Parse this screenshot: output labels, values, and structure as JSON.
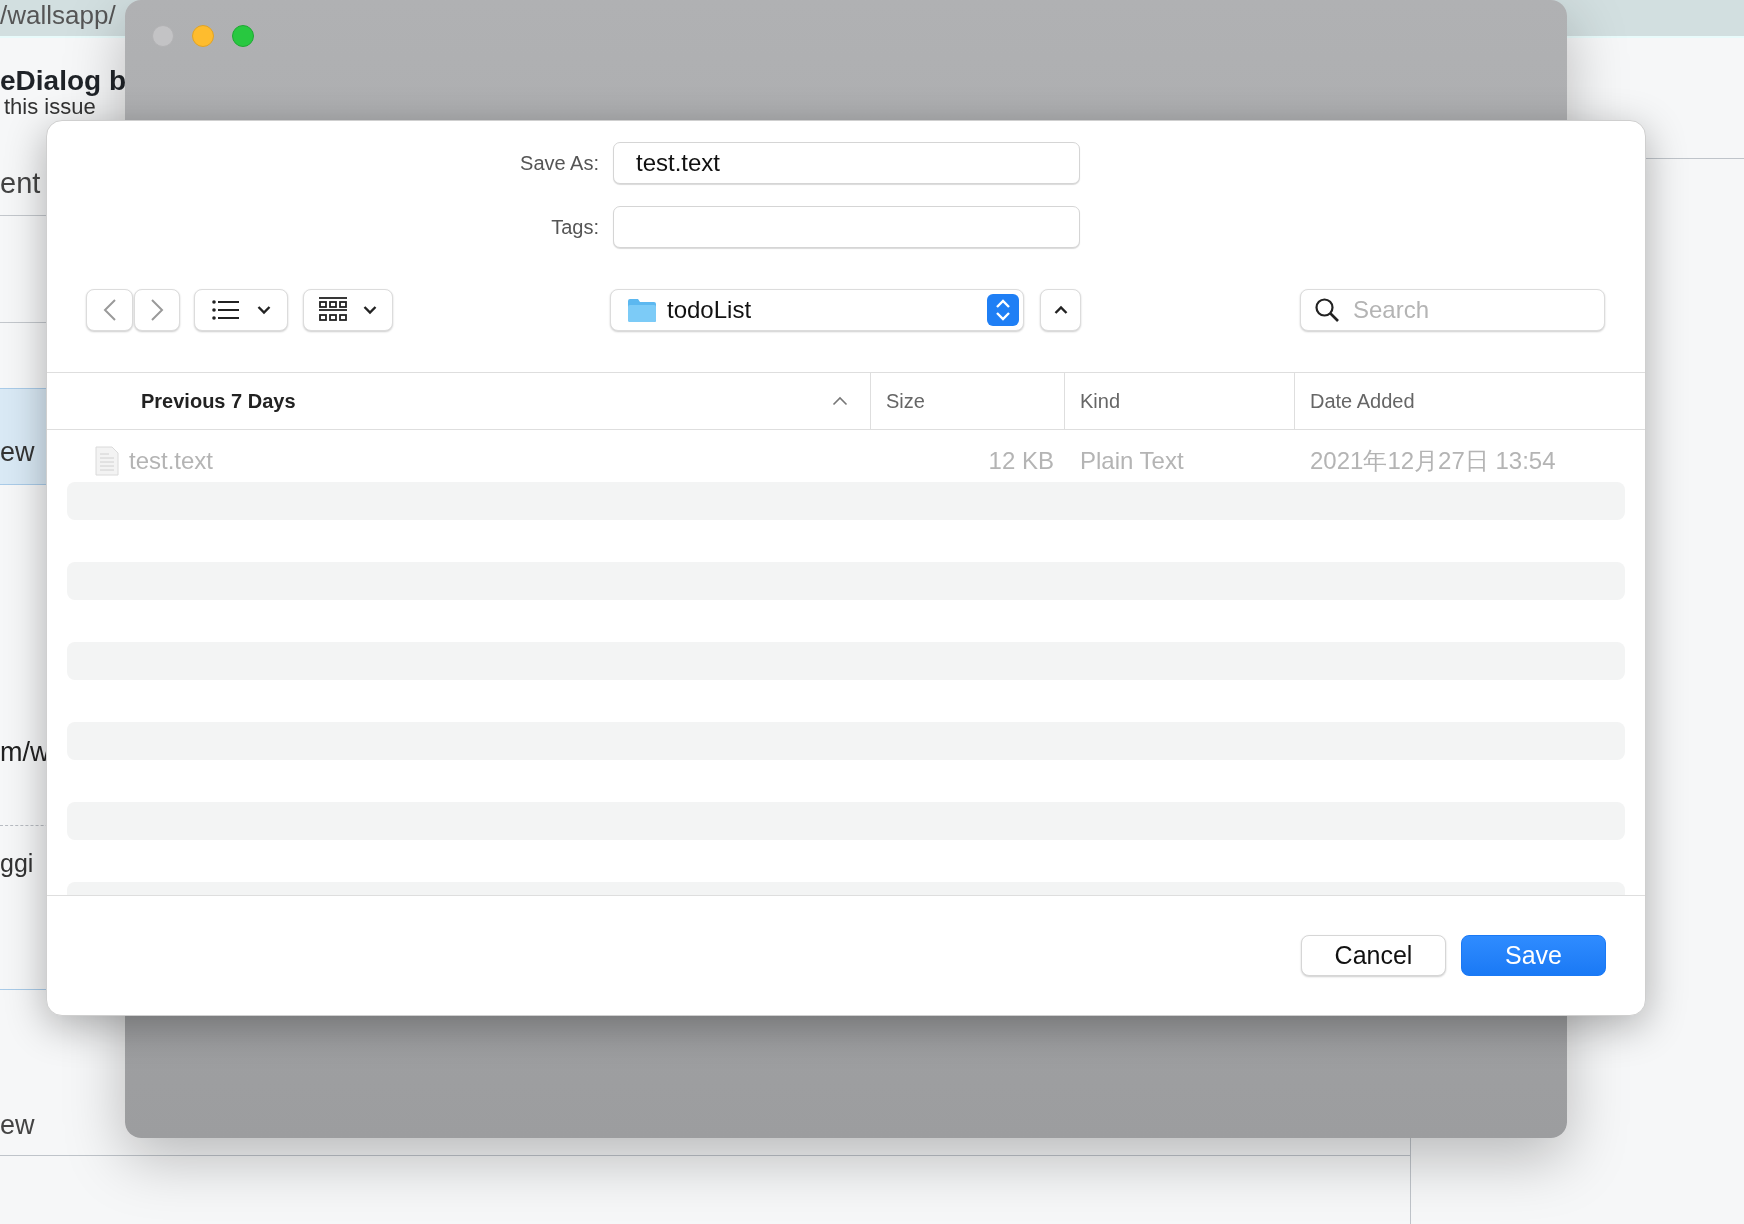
{
  "background_page": {
    "texts": [
      "/wallsapp/",
      "eDialog b",
      "this issue",
      "ent",
      "ew",
      "m/w",
      "ggi",
      "ew"
    ]
  },
  "dialog": {
    "save_as": {
      "label": "Save As:",
      "value": "test.text"
    },
    "tags": {
      "label": "Tags:"
    },
    "location": "todoList",
    "search": {
      "placeholder": "Search"
    },
    "columns": [
      {
        "label": "Previous 7 Days",
        "sorted": true
      },
      {
        "label": "Size",
        "sorted": false
      },
      {
        "label": "Kind",
        "sorted": false
      },
      {
        "label": "Date Added",
        "sorted": false
      }
    ],
    "files": [
      {
        "name": "test.text",
        "size": "12 KB",
        "kind": "Plain Text",
        "date_added": "2021年12月27日 13:54",
        "disabled": true
      }
    ],
    "buttons": [
      {
        "label": "Cancel",
        "kind": "normal"
      },
      {
        "label": "Save",
        "kind": "default"
      }
    ]
  }
}
